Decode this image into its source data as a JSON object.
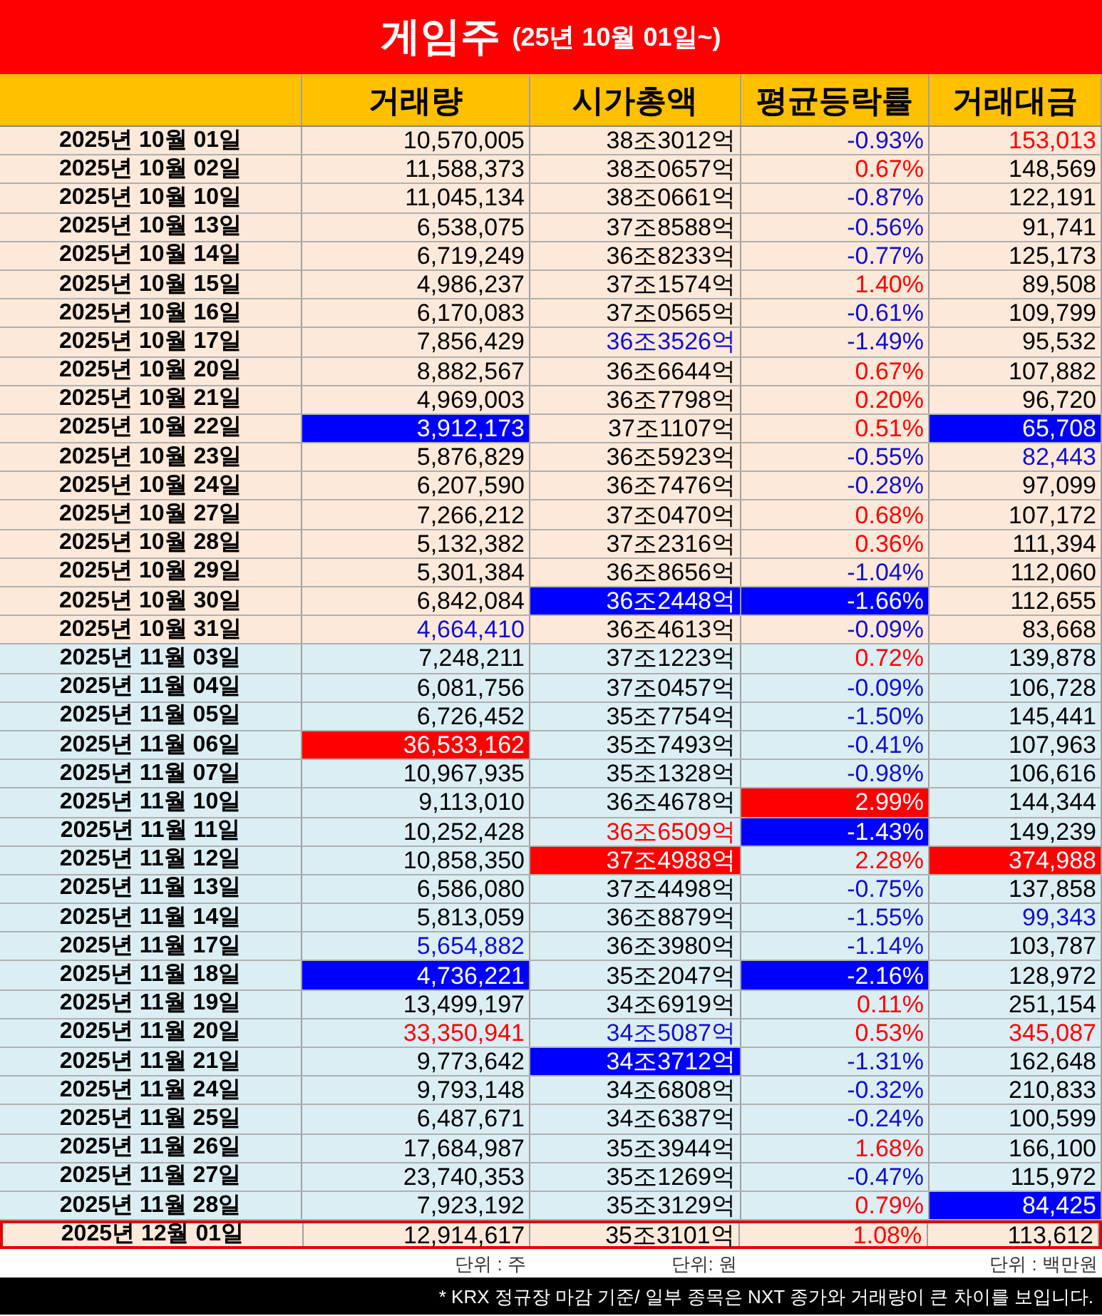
{
  "title": {
    "main": "게임주",
    "sub": "(25년 10월 01일~)"
  },
  "columns": [
    "거래량",
    "시가총액",
    "평균등락률",
    "거래대금"
  ],
  "rows": [
    {
      "date": "2025년 10월 01일",
      "color": "#fde9d9",
      "selected": false,
      "cells": [
        {
          "text": "10,570,005",
          "color": "#000000",
          "highlighted": false
        },
        {
          "text": "38조3012억",
          "color": "#000000",
          "highlighted": false
        },
        {
          "text": "-0.93%",
          "color": "#1010d0",
          "highlighted": false
        },
        {
          "text": "153,013",
          "color": "#ff0000",
          "highlighted": false
        }
      ]
    },
    {
      "date": "2025년 10월 02일",
      "color": "#fde9d9",
      "selected": false,
      "cells": [
        {
          "text": "11,588,373",
          "color": "#000000",
          "highlighted": false
        },
        {
          "text": "38조0657억",
          "color": "#000000",
          "highlighted": false
        },
        {
          "text": "0.67%",
          "color": "#ff0000",
          "highlighted": false
        },
        {
          "text": "148,569",
          "color": "#000000",
          "highlighted": false
        }
      ]
    },
    {
      "date": "2025년 10월 10일",
      "color": "#fde9d9",
      "selected": false,
      "cells": [
        {
          "text": "11,045,134",
          "color": "#000000",
          "highlighted": false
        },
        {
          "text": "38조0661억",
          "color": "#000000",
          "highlighted": false
        },
        {
          "text": "-0.87%",
          "color": "#1010d0",
          "highlighted": false
        },
        {
          "text": "122,191",
          "color": "#000000",
          "highlighted": false
        }
      ]
    },
    {
      "date": "2025년 10월 13일",
      "color": "#fde9d9",
      "selected": false,
      "cells": [
        {
          "text": "6,538,075",
          "color": "#000000",
          "highlighted": false
        },
        {
          "text": "37조8588억",
          "color": "#000000",
          "highlighted": false
        },
        {
          "text": "-0.56%",
          "color": "#1010d0",
          "highlighted": false
        },
        {
          "text": "91,741",
          "color": "#000000",
          "highlighted": false
        }
      ]
    },
    {
      "date": "2025년 10월 14일",
      "color": "#fde9d9",
      "selected": false,
      "cells": [
        {
          "text": "6,719,249",
          "color": "#000000",
          "highlighted": false
        },
        {
          "text": "36조8233억",
          "color": "#000000",
          "highlighted": false
        },
        {
          "text": "-0.77%",
          "color": "#1010d0",
          "highlighted": false
        },
        {
          "text": "125,173",
          "color": "#000000",
          "highlighted": false
        }
      ]
    },
    {
      "date": "2025년 10월 15일",
      "color": "#fde9d9",
      "selected": false,
      "cells": [
        {
          "text": "4,986,237",
          "color": "#000000",
          "highlighted": false
        },
        {
          "text": "37조1574억",
          "color": "#000000",
          "highlighted": false
        },
        {
          "text": "1.40%",
          "color": "#ff0000",
          "highlighted": false
        },
        {
          "text": "89,508",
          "color": "#000000",
          "highlighted": false
        }
      ]
    },
    {
      "date": "2025년 10월 16일",
      "color": "#fde9d9",
      "selected": false,
      "cells": [
        {
          "text": "6,170,083",
          "color": "#000000",
          "highlighted": false
        },
        {
          "text": "37조0565억",
          "color": "#000000",
          "highlighted": false
        },
        {
          "text": "-0.61%",
          "color": "#1010d0",
          "highlighted": false
        },
        {
          "text": "109,799",
          "color": "#000000",
          "highlighted": false
        }
      ]
    },
    {
      "date": "2025년 10월 17일",
      "color": "#fde9d9",
      "selected": false,
      "cells": [
        {
          "text": "7,856,429",
          "color": "#000000",
          "highlighted": false
        },
        {
          "text": "36조3526억",
          "color": "#1010d0",
          "highlighted": false
        },
        {
          "text": "-1.49%",
          "color": "#1010d0",
          "highlighted": false
        },
        {
          "text": "95,532",
          "color": "#000000",
          "highlighted": false
        }
      ]
    },
    {
      "date": "2025년 10월 20일",
      "color": "#fde9d9",
      "selected": false,
      "cells": [
        {
          "text": "8,882,567",
          "color": "#000000",
          "highlighted": false
        },
        {
          "text": "36조6644억",
          "color": "#000000",
          "highlighted": false
        },
        {
          "text": "0.67%",
          "color": "#ff0000",
          "highlighted": false
        },
        {
          "text": "107,882",
          "color": "#000000",
          "highlighted": false
        }
      ]
    },
    {
      "date": "2025년 10월 21일",
      "color": "#fde9d9",
      "selected": false,
      "cells": [
        {
          "text": "4,969,003",
          "color": "#000000",
          "highlighted": false
        },
        {
          "text": "36조7798억",
          "color": "#000000",
          "highlighted": false
        },
        {
          "text": "0.20%",
          "color": "#ff0000",
          "highlighted": false
        },
        {
          "text": "96,720",
          "color": "#000000",
          "highlighted": false
        }
      ]
    },
    {
      "date": "2025년 10월 22일",
      "color": "#fde9d9",
      "selected": false,
      "cells": [
        {
          "text": "3,912,173",
          "color": "#0000ff",
          "highlighted": true
        },
        {
          "text": "37조1107억",
          "color": "#000000",
          "highlighted": false
        },
        {
          "text": "0.51%",
          "color": "#ff0000",
          "highlighted": false
        },
        {
          "text": "65,708",
          "color": "#0000ff",
          "highlighted": true
        }
      ]
    },
    {
      "date": "2025년 10월 23일",
      "color": "#fde9d9",
      "selected": false,
      "cells": [
        {
          "text": "5,876,829",
          "color": "#000000",
          "highlighted": false
        },
        {
          "text": "36조5923억",
          "color": "#000000",
          "highlighted": false
        },
        {
          "text": "-0.55%",
          "color": "#1010d0",
          "highlighted": false
        },
        {
          "text": "82,443",
          "color": "#1010d0",
          "highlighted": false
        }
      ]
    },
    {
      "date": "2025년 10월 24일",
      "color": "#fde9d9",
      "selected": false,
      "cells": [
        {
          "text": "6,207,590",
          "color": "#000000",
          "highlighted": false
        },
        {
          "text": "36조7476억",
          "color": "#000000",
          "highlighted": false
        },
        {
          "text": "-0.28%",
          "color": "#1010d0",
          "highlighted": false
        },
        {
          "text": "97,099",
          "color": "#000000",
          "highlighted": false
        }
      ]
    },
    {
      "date": "2025년 10월 27일",
      "color": "#fde9d9",
      "selected": false,
      "cells": [
        {
          "text": "7,266,212",
          "color": "#000000",
          "highlighted": false
        },
        {
          "text": "37조0470억",
          "color": "#000000",
          "highlighted": false
        },
        {
          "text": "0.68%",
          "color": "#ff0000",
          "highlighted": false
        },
        {
          "text": "107,172",
          "color": "#000000",
          "highlighted": false
        }
      ]
    },
    {
      "date": "2025년 10월 28일",
      "color": "#fde9d9",
      "selected": false,
      "cells": [
        {
          "text": "5,132,382",
          "color": "#000000",
          "highlighted": false
        },
        {
          "text": "37조2316억",
          "color": "#000000",
          "highlighted": false
        },
        {
          "text": "0.36%",
          "color": "#ff0000",
          "highlighted": false
        },
        {
          "text": "111,394",
          "color": "#000000",
          "highlighted": false
        }
      ]
    },
    {
      "date": "2025년 10월 29일",
      "color": "#fde9d9",
      "selected": false,
      "cells": [
        {
          "text": "5,301,384",
          "color": "#000000",
          "highlighted": false
        },
        {
          "text": "36조8656억",
          "color": "#000000",
          "highlighted": false
        },
        {
          "text": "-1.04%",
          "color": "#1010d0",
          "highlighted": false
        },
        {
          "text": "112,060",
          "color": "#000000",
          "highlighted": false
        }
      ]
    },
    {
      "date": "2025년 10월 30일",
      "color": "#fde9d9",
      "selected": false,
      "cells": [
        {
          "text": "6,842,084",
          "color": "#000000",
          "highlighted": false
        },
        {
          "text": "36조2448억",
          "color": "#0000ff",
          "highlighted": true
        },
        {
          "text": "-1.66%",
          "color": "#0000ff",
          "highlighted": true
        },
        {
          "text": "112,655",
          "color": "#000000",
          "highlighted": false
        }
      ]
    },
    {
      "date": "2025년 10월 31일",
      "color": "#fde9d9",
      "selected": false,
      "cells": [
        {
          "text": "4,664,410",
          "color": "#1010d0",
          "highlighted": false
        },
        {
          "text": "36조4613억",
          "color": "#000000",
          "highlighted": false
        },
        {
          "text": "-0.09%",
          "color": "#1010d0",
          "highlighted": false
        },
        {
          "text": "83,668",
          "color": "#000000",
          "highlighted": false
        }
      ]
    },
    {
      "date": "2025년 11월 03일",
      "color": "#dbeef4",
      "selected": false,
      "cells": [
        {
          "text": "7,248,211",
          "color": "#000000",
          "highlighted": false
        },
        {
          "text": "37조1223억",
          "color": "#000000",
          "highlighted": false
        },
        {
          "text": "0.72%",
          "color": "#ff0000",
          "highlighted": false
        },
        {
          "text": "139,878",
          "color": "#000000",
          "highlighted": false
        }
      ]
    },
    {
      "date": "2025년 11월 04일",
      "color": "#dbeef4",
      "selected": false,
      "cells": [
        {
          "text": "6,081,756",
          "color": "#000000",
          "highlighted": false
        },
        {
          "text": "37조0457억",
          "color": "#000000",
          "highlighted": false
        },
        {
          "text": "-0.09%",
          "color": "#1010d0",
          "highlighted": false
        },
        {
          "text": "106,728",
          "color": "#000000",
          "highlighted": false
        }
      ]
    },
    {
      "date": "2025년 11월 05일",
      "color": "#dbeef4",
      "selected": false,
      "cells": [
        {
          "text": "6,726,452",
          "color": "#000000",
          "highlighted": false
        },
        {
          "text": "35조7754억",
          "color": "#000000",
          "highlighted": false
        },
        {
          "text": "-1.50%",
          "color": "#1010d0",
          "highlighted": false
        },
        {
          "text": "145,441",
          "color": "#000000",
          "highlighted": false
        }
      ]
    },
    {
      "date": "2025년 11월 06일",
      "color": "#dbeef4",
      "selected": false,
      "cells": [
        {
          "text": "36,533,162",
          "color": "#ff0000",
          "highlighted": true
        },
        {
          "text": "35조7493억",
          "color": "#000000",
          "highlighted": false
        },
        {
          "text": "-0.41%",
          "color": "#1010d0",
          "highlighted": false
        },
        {
          "text": "107,963",
          "color": "#000000",
          "highlighted": false
        }
      ]
    },
    {
      "date": "2025년 11월 07일",
      "color": "#dbeef4",
      "selected": false,
      "cells": [
        {
          "text": "10,967,935",
          "color": "#000000",
          "highlighted": false
        },
        {
          "text": "35조1328억",
          "color": "#000000",
          "highlighted": false
        },
        {
          "text": "-0.98%",
          "color": "#1010d0",
          "highlighted": false
        },
        {
          "text": "106,616",
          "color": "#000000",
          "highlighted": false
        }
      ]
    },
    {
      "date": "2025년 11월 10일",
      "color": "#dbeef4",
      "selected": false,
      "cells": [
        {
          "text": "9,113,010",
          "color": "#000000",
          "highlighted": false
        },
        {
          "text": "36조4678억",
          "color": "#000000",
          "highlighted": false
        },
        {
          "text": "2.99%",
          "color": "#ff0000",
          "highlighted": true
        },
        {
          "text": "144,344",
          "color": "#000000",
          "highlighted": false
        }
      ]
    },
    {
      "date": "2025년 11월 11일",
      "color": "#dbeef4",
      "selected": false,
      "cells": [
        {
          "text": "10,252,428",
          "color": "#000000",
          "highlighted": false
        },
        {
          "text": "36조6509억",
          "color": "#ff0000",
          "highlighted": false
        },
        {
          "text": "-1.43%",
          "color": "#0000ff",
          "highlighted": true
        },
        {
          "text": "149,239",
          "color": "#000000",
          "highlighted": false
        }
      ]
    },
    {
      "date": "2025년 11월 12일",
      "color": "#dbeef4",
      "selected": false,
      "cells": [
        {
          "text": "10,858,350",
          "color": "#000000",
          "highlighted": false
        },
        {
          "text": "37조4988억",
          "color": "#ff0000",
          "highlighted": true
        },
        {
          "text": "2.28%",
          "color": "#ff0000",
          "highlighted": false
        },
        {
          "text": "374,988",
          "color": "#ff0000",
          "highlighted": true
        }
      ]
    },
    {
      "date": "2025년 11월 13일",
      "color": "#dbeef4",
      "selected": false,
      "cells": [
        {
          "text": "6,586,080",
          "color": "#000000",
          "highlighted": false
        },
        {
          "text": "37조4498억",
          "color": "#000000",
          "highlighted": false
        },
        {
          "text": "-0.75%",
          "color": "#1010d0",
          "highlighted": false
        },
        {
          "text": "137,858",
          "color": "#000000",
          "highlighted": false
        }
      ]
    },
    {
      "date": "2025년 11월 14일",
      "color": "#dbeef4",
      "selected": false,
      "cells": [
        {
          "text": "5,813,059",
          "color": "#000000",
          "highlighted": false
        },
        {
          "text": "36조8879억",
          "color": "#000000",
          "highlighted": false
        },
        {
          "text": "-1.55%",
          "color": "#1010d0",
          "highlighted": false
        },
        {
          "text": "99,343",
          "color": "#1010d0",
          "highlighted": false
        }
      ]
    },
    {
      "date": "2025년 11월 17일",
      "color": "#dbeef4",
      "selected": false,
      "cells": [
        {
          "text": "5,654,882",
          "color": "#1010d0",
          "highlighted": false
        },
        {
          "text": "36조3980억",
          "color": "#000000",
          "highlighted": false
        },
        {
          "text": "-1.14%",
          "color": "#1010d0",
          "highlighted": false
        },
        {
          "text": "103,787",
          "color": "#000000",
          "highlighted": false
        }
      ]
    },
    {
      "date": "2025년 11월 18일",
      "color": "#dbeef4",
      "selected": false,
      "cells": [
        {
          "text": "4,736,221",
          "color": "#0000ff",
          "highlighted": true
        },
        {
          "text": "35조2047억",
          "color": "#000000",
          "highlighted": false
        },
        {
          "text": "-2.16%",
          "color": "#0000ff",
          "highlighted": true
        },
        {
          "text": "128,972",
          "color": "#000000",
          "highlighted": false
        }
      ]
    },
    {
      "date": "2025년 11월 19일",
      "color": "#dbeef4",
      "selected": false,
      "cells": [
        {
          "text": "13,499,197",
          "color": "#000000",
          "highlighted": false
        },
        {
          "text": "34조6919억",
          "color": "#000000",
          "highlighted": false
        },
        {
          "text": "0.11%",
          "color": "#ff0000",
          "highlighted": false
        },
        {
          "text": "251,154",
          "color": "#000000",
          "highlighted": false
        }
      ]
    },
    {
      "date": "2025년 11월 20일",
      "color": "#dbeef4",
      "selected": false,
      "cells": [
        {
          "text": "33,350,941",
          "color": "#ff0000",
          "highlighted": false
        },
        {
          "text": "34조5087억",
          "color": "#1010d0",
          "highlighted": false
        },
        {
          "text": "0.53%",
          "color": "#ff0000",
          "highlighted": false
        },
        {
          "text": "345,087",
          "color": "#ff0000",
          "highlighted": false
        }
      ]
    },
    {
      "date": "2025년 11월 21일",
      "color": "#dbeef4",
      "selected": false,
      "cells": [
        {
          "text": "9,773,642",
          "color": "#000000",
          "highlighted": false
        },
        {
          "text": "34조3712억",
          "color": "#0000ff",
          "highlighted": true
        },
        {
          "text": "-1.31%",
          "color": "#1010d0",
          "highlighted": false
        },
        {
          "text": "162,648",
          "color": "#000000",
          "highlighted": false
        }
      ]
    },
    {
      "date": "2025년 11월 24일",
      "color": "#dbeef4",
      "selected": false,
      "cells": [
        {
          "text": "9,793,148",
          "color": "#000000",
          "highlighted": false
        },
        {
          "text": "34조6808억",
          "color": "#000000",
          "highlighted": false
        },
        {
          "text": "-0.32%",
          "color": "#1010d0",
          "highlighted": false
        },
        {
          "text": "210,833",
          "color": "#000000",
          "highlighted": false
        }
      ]
    },
    {
      "date": "2025년 11월 25일",
      "color": "#dbeef4",
      "selected": false,
      "cells": [
        {
          "text": "6,487,671",
          "color": "#000000",
          "highlighted": false
        },
        {
          "text": "34조6387억",
          "color": "#000000",
          "highlighted": false
        },
        {
          "text": "-0.24%",
          "color": "#1010d0",
          "highlighted": false
        },
        {
          "text": "100,599",
          "color": "#000000",
          "highlighted": false
        }
      ]
    },
    {
      "date": "2025년 11월 26일",
      "color": "#dbeef4",
      "selected": false,
      "cells": [
        {
          "text": "17,684,987",
          "color": "#000000",
          "highlighted": false
        },
        {
          "text": "35조3944억",
          "color": "#000000",
          "highlighted": false
        },
        {
          "text": "1.68%",
          "color": "#ff0000",
          "highlighted": false
        },
        {
          "text": "166,100",
          "color": "#000000",
          "highlighted": false
        }
      ]
    },
    {
      "date": "2025년 11월 27일",
      "color": "#dbeef4",
      "selected": false,
      "cells": [
        {
          "text": "23,740,353",
          "color": "#000000",
          "highlighted": false
        },
        {
          "text": "35조1269억",
          "color": "#000000",
          "highlighted": false
        },
        {
          "text": "-0.47%",
          "color": "#1010d0",
          "highlighted": false
        },
        {
          "text": "115,972",
          "color": "#000000",
          "highlighted": false
        }
      ]
    },
    {
      "date": "2025년 11월 28일",
      "color": "#dbeef4",
      "selected": false,
      "cells": [
        {
          "text": "7,923,192",
          "color": "#000000",
          "highlighted": false
        },
        {
          "text": "35조3129억",
          "color": "#000000",
          "highlighted": false
        },
        {
          "text": "0.79%",
          "color": "#ff0000",
          "highlighted": false
        },
        {
          "text": "84,425",
          "color": "#0000ff",
          "highlighted": true
        }
      ]
    },
    {
      "date": "2025년 12월 01일",
      "color": "#fde9d9",
      "selected": true,
      "cells": [
        {
          "text": "12,914,617",
          "color": "#000000",
          "highlighted": false
        },
        {
          "text": "35조3101억",
          "color": "#000000",
          "highlighted": false
        },
        {
          "text": "1.08%",
          "color": "#ff0000",
          "highlighted": false
        },
        {
          "text": "113,612",
          "color": "#000000",
          "highlighted": false
        }
      ]
    }
  ],
  "units": [
    "단위 : 주",
    "단위: 원",
    "단위 : 백만원"
  ],
  "note": "* KRX 정규장 마감 기준/ 일부 종목은 NXT 종가와 거래량이 큰 차이를 보입니다."
}
